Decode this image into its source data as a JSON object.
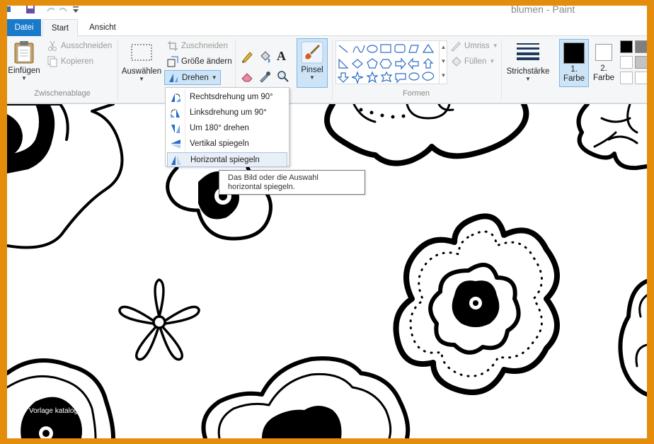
{
  "window": {
    "title": "blumen - Paint"
  },
  "tabs": [
    {
      "label": "Datei"
    },
    {
      "label": "Start"
    },
    {
      "label": "Ansicht"
    }
  ],
  "ribbon": {
    "clipboard": {
      "group_label": "Zwischenablage",
      "paste_label": "Einfügen",
      "cut_label": "Ausschneiden",
      "copy_label": "Kopieren"
    },
    "image": {
      "select_label": "Auswählen",
      "crop_label": "Zuschneiden",
      "resize_label": "Größe ändern",
      "rotate_label": "Drehen"
    },
    "tools": {
      "brush_label": "Pinsel"
    },
    "shapes": {
      "group_label": "Formen",
      "outline_label": "Umriss",
      "fill_label": "Füllen"
    },
    "stroke": {
      "label": "Strichstärke"
    },
    "colors": {
      "color1_line1": "1.",
      "color1_line2": "Farbe",
      "color2_line1": "2.",
      "color2_line2": "Farbe",
      "color1": "#000000",
      "color2": "#ffffff"
    }
  },
  "rotate_menu": {
    "items": [
      {
        "label": "Rechtsdrehung um 90°",
        "icon": "rotate-right-icon"
      },
      {
        "label": "Linksdrehung um 90°",
        "icon": "rotate-left-icon"
      },
      {
        "label": "Um 180° drehen",
        "icon": "rotate-180-icon"
      },
      {
        "label": "Vertikal spiegeln",
        "icon": "flip-vertical-icon"
      },
      {
        "label": "Horizontal spiegeln",
        "icon": "flip-horizontal-icon"
      }
    ]
  },
  "tooltip": {
    "line1": "Das Bild oder die Auswahl",
    "line2": "horizontal spiegeln."
  },
  "watermark": "Vorlage katalog",
  "theme": {
    "accent": "#1979ca",
    "frame": "#e48d0c",
    "ribbon_bg": "#f5f6f7"
  }
}
